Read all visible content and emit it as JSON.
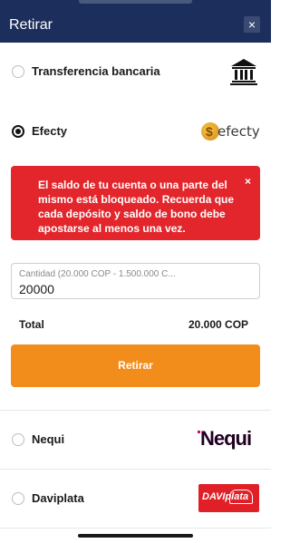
{
  "header": {
    "title": "Retirar",
    "close_label": "×"
  },
  "options": {
    "bank_transfer": {
      "label": "Transferencia bancaria",
      "selected": false,
      "icon": "bank-icon"
    },
    "efecty": {
      "label": "Efecty",
      "selected": true,
      "logo_text": "efecty",
      "logo_coin": "$"
    },
    "nequi": {
      "label": "Nequi",
      "selected": false,
      "logo_text": "Nequi"
    },
    "daviplata": {
      "label": "Daviplata",
      "selected": false,
      "logo_text": "DAVIplata"
    }
  },
  "alert": {
    "message": "El saldo de tu cuenta o una parte del mismo está bloqueado. Recuerda que cada depósito y saldo de bono debe apostarse al menos una vez.",
    "close_label": "×",
    "color": "#e2262c"
  },
  "amount": {
    "placeholder": "Cantidad (20.000 COP - 1.500.000 C...",
    "value": "20000"
  },
  "total": {
    "label": "Total",
    "value": "20.000 COP"
  },
  "submit": {
    "label": "Retirar",
    "color": "#f28c1a"
  },
  "colors": {
    "header": "#1c2f5c",
    "accent": "#f28c1a",
    "danger": "#e2262c"
  }
}
